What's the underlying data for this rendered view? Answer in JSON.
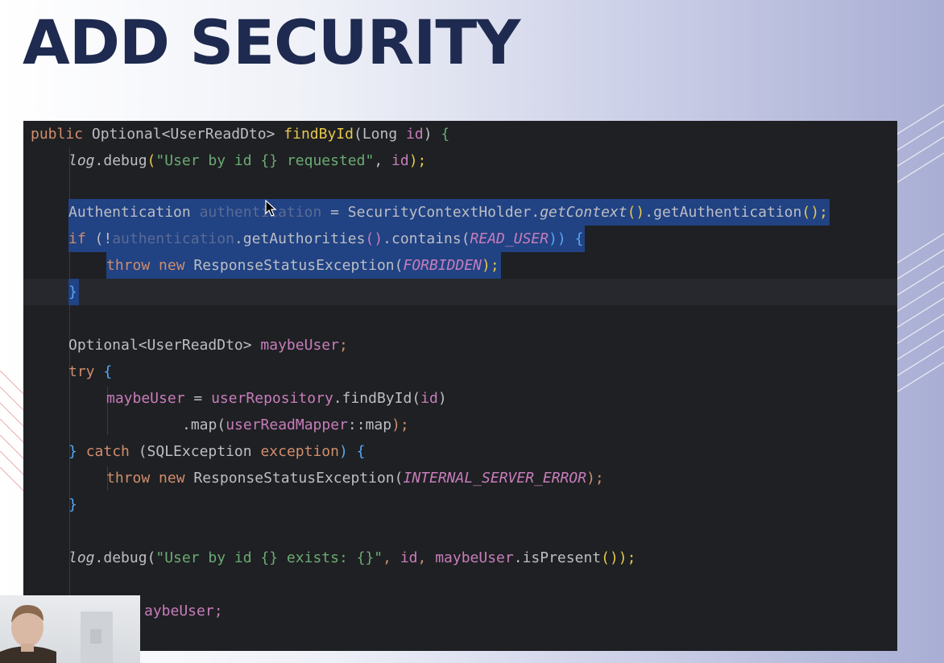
{
  "slide": {
    "title": "ADD SECURITY"
  },
  "editor": {
    "lines": {
      "l1": {
        "kw_public": "public",
        "type_optional": " Optional<UserReadDto> ",
        "fn_name": "findById",
        "p_open": "(",
        "long": "Long ",
        "param_id": "id",
        "p_close": ")",
        "rest": " {"
      },
      "l2": {
        "log": "log",
        "dot_debug": ".debug",
        "p_open": "(",
        "str": "\"User by id {} requested\"",
        "comma": ", ",
        "id": "id",
        "end": ");"
      },
      "l4": {
        "type": "Authentication ",
        "var": "authentication",
        "eq": " = SecurityContextHolder.",
        "getContext": "getContext",
        "paren": "()",
        "get_auth": ".getAuthentication",
        "end": "();"
      },
      "l5": {
        "kw_if": "if",
        "open": " (!",
        "var": "authentication",
        "getAuth": ".getAuthorities",
        "paren": "()",
        "contains": ".contains(",
        "const": "READ_USER",
        "close": ")) {"
      },
      "l6": {
        "kw_throw": "throw",
        "kw_new": " new",
        "ctor": " ResponseStatusException(",
        "const": "FORBIDDEN",
        "end": ");"
      },
      "l7": {
        "brace": "}"
      },
      "l9": {
        "type": "Optional<UserReadDto> ",
        "var": "maybeUser",
        "end": ";"
      },
      "l10": {
        "kw_try": "try",
        "brace": " {"
      },
      "l11": {
        "var": "maybeUser",
        "eq": " = ",
        "repo": "userRepository",
        "find": ".findById(",
        "id": "id",
        "close": ")"
      },
      "l12": {
        "map": ".map(",
        "mapper": "userReadMapper",
        "ref": "::map",
        "end": ");"
      },
      "l13": {
        "brace_close": "} ",
        "kw_catch": "catch",
        "open": " (SQLException ",
        "var": "exception",
        "close": ") {"
      },
      "l14": {
        "kw_throw": "throw",
        "kw_new": " new",
        "ctor": " ResponseStatusException(",
        "const": "INTERNAL_SERVER_ERROR",
        "end": ");"
      },
      "l15": {
        "brace": "}"
      },
      "l17": {
        "log": "log",
        "dot_debug": ".debug(",
        "str": "\"User by id {} exists: {}\"",
        "comma": ", ",
        "id": "id",
        "comma2": ", ",
        "var": "maybeUser",
        "is": ".isPresent",
        "end": "());"
      },
      "l19": {
        "tail": "aybeUser;"
      }
    }
  },
  "colors": {
    "title": "#1e2a4f",
    "editor_bg": "#1f2023",
    "selection": "#214283",
    "keyword": "#cf8e6d",
    "string": "#6aab73",
    "method": "#56a8f5",
    "field": "#c77dbb"
  },
  "icons": {
    "cursor": "text-cursor-icon"
  }
}
